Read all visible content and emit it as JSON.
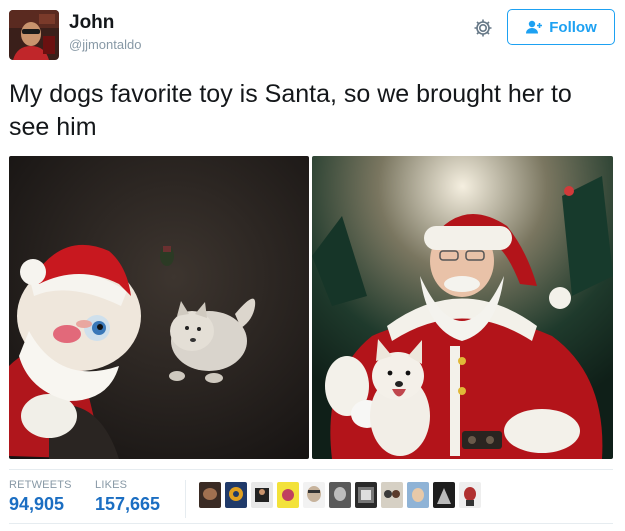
{
  "user": {
    "name": "John",
    "handle": "@jjmontaldo"
  },
  "header": {
    "follow_label": "Follow",
    "settings_icon": "gear-icon",
    "follow_icon": "add-user-icon"
  },
  "tweet": {
    "text": "My dogs favorite toy is Santa, so we brought her to see him"
  },
  "stats": {
    "retweets_label": "RETWEETS",
    "retweets_count": "94,905",
    "likes_label": "LIKES",
    "likes_count": "157,665"
  },
  "colors": {
    "accent": "#1da1f2",
    "count": "#1b6ec2",
    "muted": "#8899a6",
    "text": "#14171a"
  }
}
